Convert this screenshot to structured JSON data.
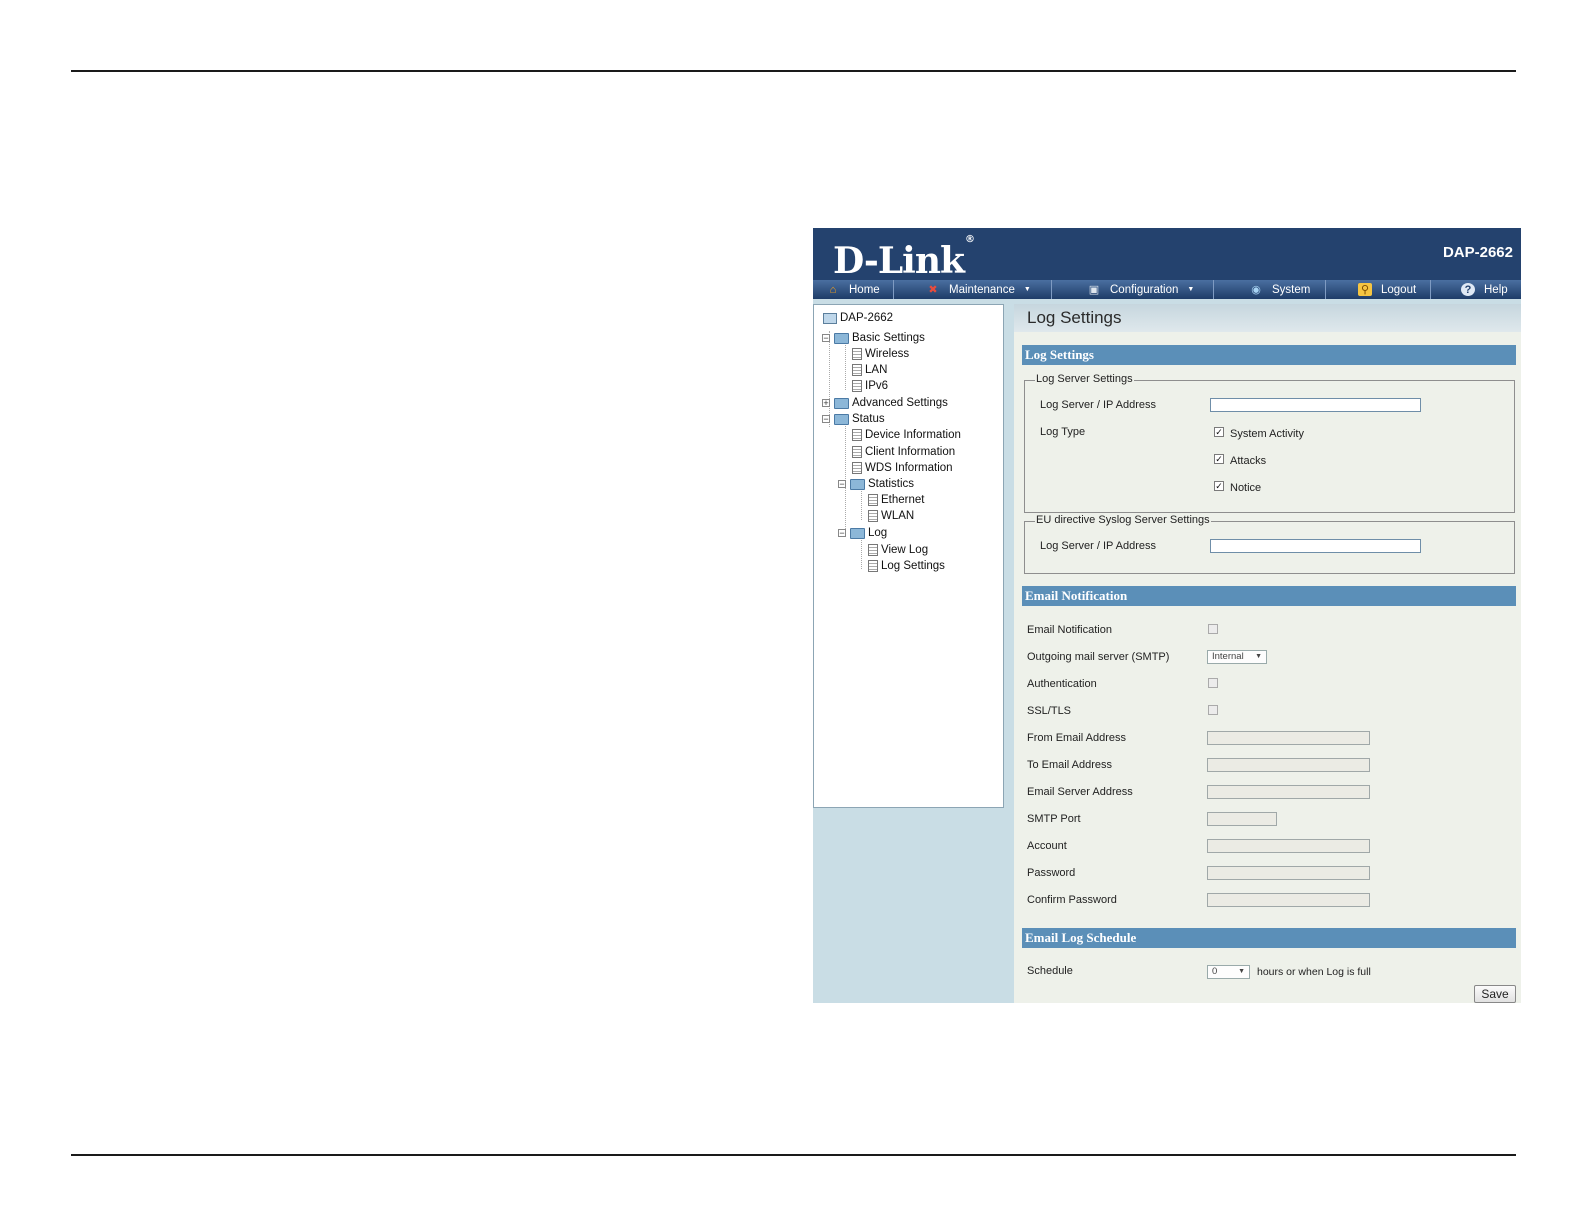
{
  "header": {
    "logo": "D-Link",
    "logo_mark": "®",
    "model": "DAP-2662"
  },
  "nav": {
    "home": "Home",
    "maintenance": "Maintenance",
    "configuration": "Configuration",
    "system": "System",
    "logout": "Logout",
    "help": "Help"
  },
  "tree": {
    "root": "DAP-2662",
    "basic_settings": "Basic Settings",
    "wireless": "Wireless",
    "lan": "LAN",
    "ipv6": "IPv6",
    "advanced_settings": "Advanced Settings",
    "status": "Status",
    "device_information": "Device Information",
    "client_information": "Client Information",
    "wds_information": "WDS Information",
    "statistics": "Statistics",
    "ethernet": "Ethernet",
    "wlan": "WLAN",
    "log": "Log",
    "view_log": "View Log",
    "log_settings": "Log Settings"
  },
  "main": {
    "page_title": "Log Settings",
    "log_settings_header": "Log Settings",
    "log_server_legend": "Log Server Settings",
    "log_server_label": "Log Server / IP Address",
    "log_server_value": "",
    "log_type_label": "Log Type",
    "log_types": [
      {
        "label": "System Activity",
        "checked": true
      },
      {
        "label": "Attacks",
        "checked": true
      },
      {
        "label": "Notice",
        "checked": true
      }
    ],
    "eu_legend": "EU directive Syslog Server Settings",
    "eu_log_server_label": "Log Server / IP Address",
    "eu_log_server_value": "",
    "email_header": "Email Notification",
    "email_notification_label": "Email Notification",
    "email_notification_checked": false,
    "smtp_label": "Outgoing mail server (SMTP)",
    "smtp_value": "Internal",
    "authentication_label": "Authentication",
    "ssl_tls_label": "SSL/TLS",
    "from_email_label": "From Email Address",
    "to_email_label": "To Email Address",
    "email_server_label": "Email Server Address",
    "smtp_port_label": "SMTP Port",
    "account_label": "Account",
    "password_label": "Password",
    "confirm_password_label": "Confirm Password",
    "schedule_header": "Email Log Schedule",
    "schedule_label": "Schedule",
    "schedule_value": "0",
    "schedule_suffix": "hours or when Log is full",
    "save_label": "Save"
  },
  "colors": {
    "header_bg": "#24426e",
    "section_bar": "#5b8fb8",
    "main_bg": "#eef1ea",
    "sidebar_bg": "#c9dde5"
  },
  "icons": {
    "home": "home-icon",
    "maintenance": "tools-icon",
    "configuration": "computer-icon",
    "system": "globe-icon",
    "logout": "key-icon",
    "help": "help-icon"
  }
}
